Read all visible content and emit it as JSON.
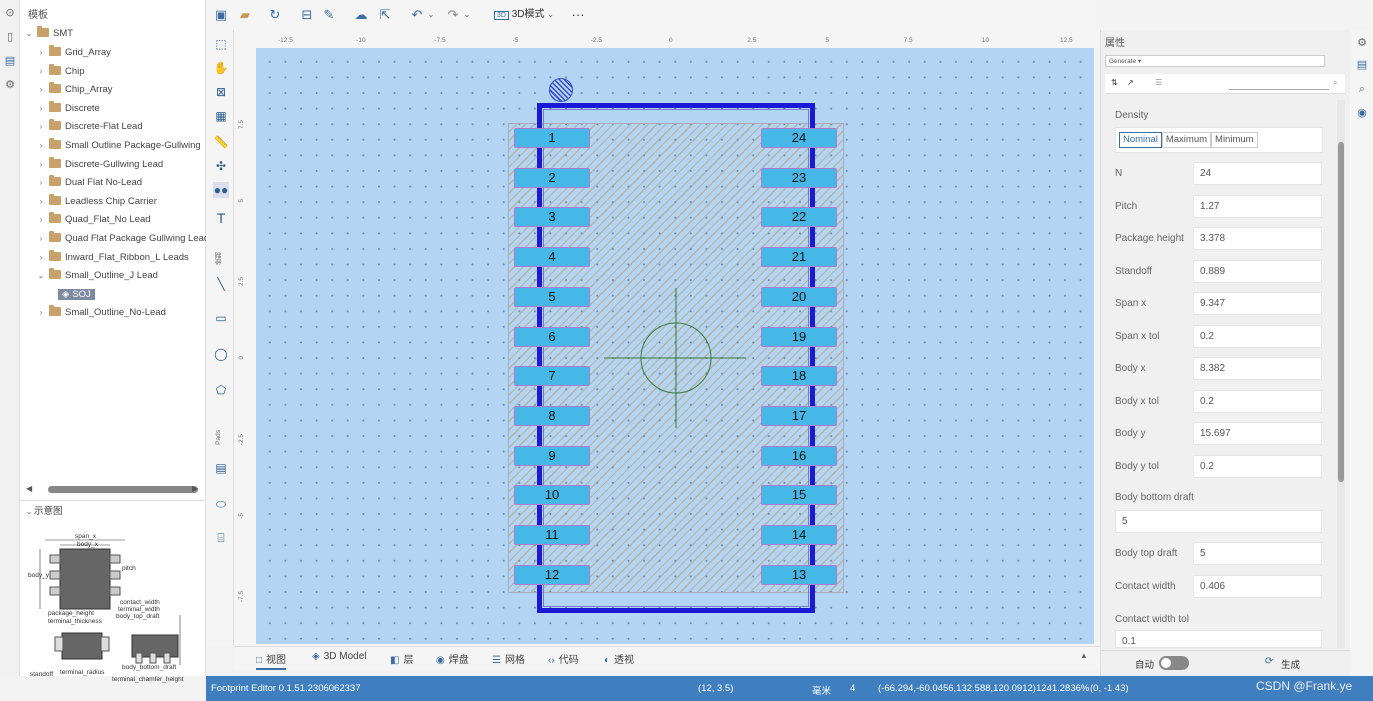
{
  "tree": {
    "title": "模板",
    "root": "SMT",
    "items": [
      {
        "label": "Grid_Array"
      },
      {
        "label": "Chip"
      },
      {
        "label": "Chip_Array"
      },
      {
        "label": "Discrete"
      },
      {
        "label": "Discrete-Flat Lead"
      },
      {
        "label": "Small Outline Package-Gullwing"
      },
      {
        "label": "Discrete-Gullwing Lead"
      },
      {
        "label": "Dual Flat No-Lead"
      },
      {
        "label": "Leadless Chip Carrier"
      },
      {
        "label": "Quad_Flat_No Lead"
      },
      {
        "label": "Quad Flat Package Gullwing Lead"
      },
      {
        "label": "Inward_Flat_Ribbon_L Leads"
      },
      {
        "label": "Small_Outline_J Lead"
      },
      {
        "label": "SOJ"
      },
      {
        "label": "Small_Outline_No-Lead"
      }
    ]
  },
  "preview": {
    "title": "示意图",
    "labels": {
      "span_x": "span_x",
      "body_x": "body_x",
      "body_y": "body_y",
      "pitch": "pitch",
      "package_height": "package_height",
      "terminal_thickness": "terminal_thickness",
      "contact_width": "contact_width",
      "terminal_width": "terminal_width",
      "body_top_draft": "body_top_draft",
      "body_bottom_draft": "body_bottom_draft",
      "standoff": "standoff",
      "terminal_radius": "terminal_radius",
      "terminal_chamfer_height": "terminal_chamfer_height"
    }
  },
  "toolbar": {
    "view_mode": "3D模式",
    "more": "···"
  },
  "vtools": {
    "label1": "绘制",
    "label2": "Pads"
  },
  "ruler": {
    "h_ticks": [
      "-12.5",
      "-10",
      "-7.5",
      "-5",
      "-2.5",
      "0",
      "2.5",
      "5",
      "7.5",
      "10",
      "12.5"
    ],
    "v_ticks": [
      "7.5",
      "5",
      "2.5",
      "0",
      "-2.5",
      "-5",
      "-7.5"
    ]
  },
  "pads": {
    "left": [
      "1",
      "2",
      "3",
      "4",
      "5",
      "6",
      "7",
      "8",
      "9",
      "10",
      "11",
      "12"
    ],
    "right": [
      "24",
      "23",
      "22",
      "21",
      "20",
      "19",
      "18",
      "17",
      "16",
      "15",
      "14",
      "13"
    ]
  },
  "tabs": [
    {
      "label": "视图",
      "icon": "□"
    },
    {
      "label": "3D Model",
      "icon": "◈"
    },
    {
      "label": "层",
      "icon": "◧"
    },
    {
      "label": "焊盘",
      "icon": "◉"
    },
    {
      "label": "网格",
      "icon": "☰"
    },
    {
      "label": "代码",
      "icon": "‹›"
    },
    {
      "label": "透视",
      "icon": "◐"
    }
  ],
  "properties": {
    "title": "属性",
    "selector": "Generate ▾",
    "density_label": "Density",
    "density_options": [
      "Nominal",
      "Maximum",
      "Minimum"
    ],
    "density_selected": "Nominal",
    "rows": [
      {
        "label": "N",
        "value": "24"
      },
      {
        "label": "Pitch",
        "value": "1.27"
      },
      {
        "label": "Package height",
        "value": "3.378"
      },
      {
        "label": "Standoff",
        "value": "0.889"
      },
      {
        "label": "Span x",
        "value": "9.347"
      },
      {
        "label": "Span x tol",
        "value": "0.2"
      },
      {
        "label": "Body x",
        "value": "8.382"
      },
      {
        "label": "Body x tol",
        "value": "0.2"
      },
      {
        "label": "Body y",
        "value": "15.697"
      },
      {
        "label": "Body y tol",
        "value": "0.2"
      }
    ],
    "body_bottom_draft_label": "Body bottom draft",
    "body_bottom_draft_value": "5",
    "body_top_draft_label": "Body top draft",
    "body_top_draft_value": "5",
    "contact_width_label": "Contact width",
    "contact_width_value": "0.406",
    "contact_width_tol_label": "Contact width tol",
    "contact_width_tol_value": "0.1",
    "auto_label": "自动",
    "generate_label": "生成"
  },
  "status": {
    "app": "Footprint Editor 0.1.51.2306062337",
    "cursor": "(12, 3.5)",
    "unit": "毫米",
    "grid": "4",
    "bounds": "(-66.294,-60.0456,132.588,120.0912)",
    "zoom": "1241.2836%",
    "pos": "(0, -1.43)",
    "watermark": "CSDN @Frank.ye"
  }
}
